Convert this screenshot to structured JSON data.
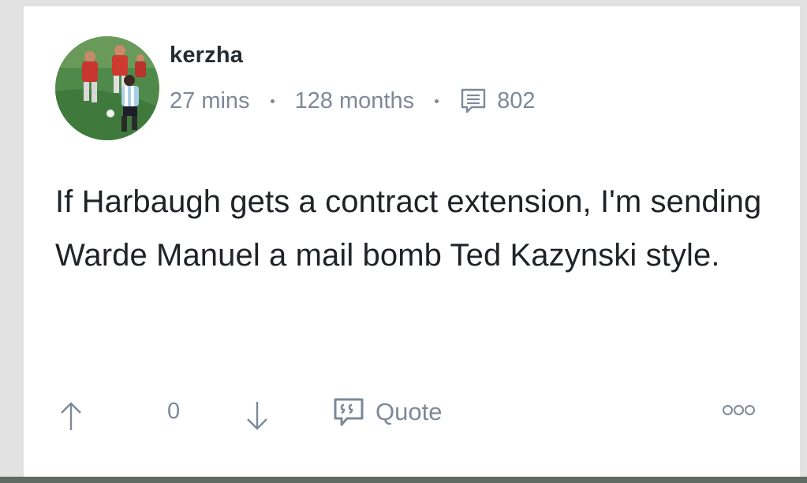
{
  "post": {
    "author": "kerzha",
    "time_ago": "27 mins",
    "account_age": "128 months",
    "comment_count": "802",
    "body": "If Harbaugh gets a contract extension, I'm sending Warde Manuel a mail bomb Ted Kazynski style.",
    "vote_count": "0",
    "quote_label": "Quote"
  },
  "icons": {
    "avatar": "avatar-image",
    "comment": "comment-icon",
    "upvote": "arrow-up-icon",
    "downvote": "arrow-down-icon",
    "quote": "quote-icon",
    "more": "more-options-icon"
  },
  "colors": {
    "text": "#1f2226",
    "muted": "#7e8997",
    "username": "#262b33",
    "card": "#ffffff"
  }
}
